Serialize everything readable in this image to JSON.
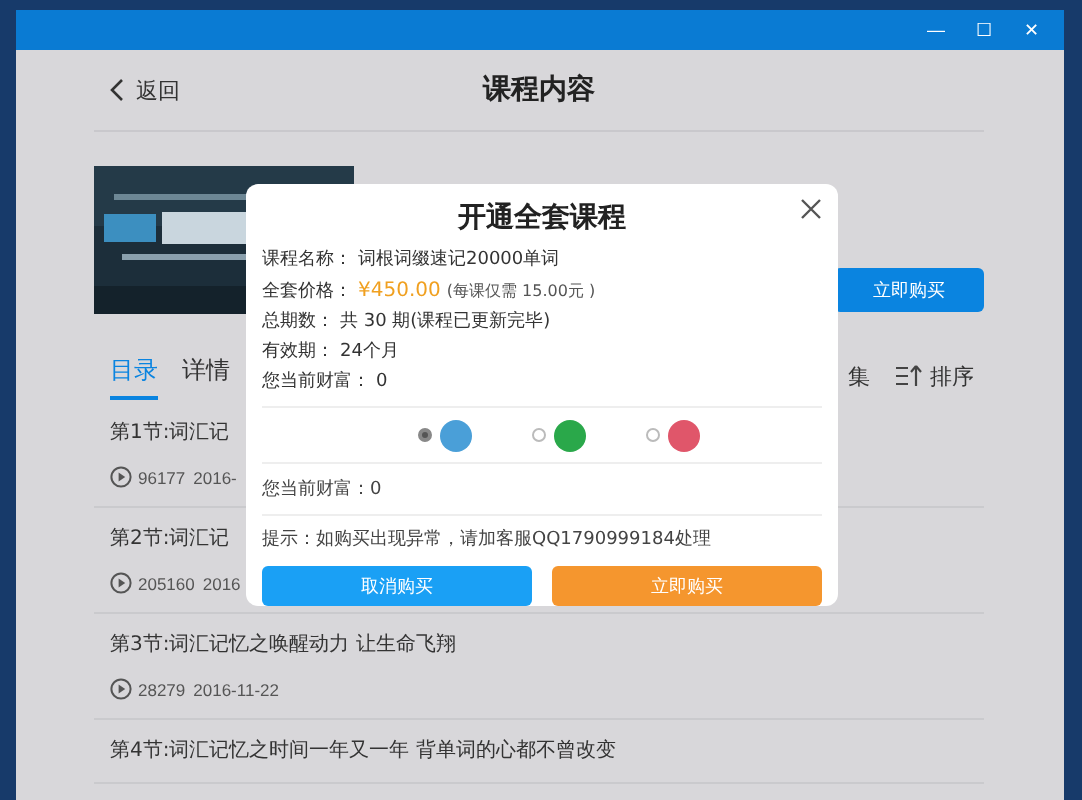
{
  "window": {
    "title_bar_buttons": [
      "—",
      "☐",
      "✕"
    ]
  },
  "header": {
    "back": "返回",
    "title": "课程内容"
  },
  "course": {
    "buy_button": "立即购买"
  },
  "tabs": [
    {
      "label": "目录",
      "selected": true
    },
    {
      "label": "详情",
      "selected": false
    }
  ],
  "tools": {
    "select": "集",
    "sort": "排序"
  },
  "lessons": [
    {
      "title": "第1节:词汇记",
      "plays": "96177",
      "date": "2016-"
    },
    {
      "title": "第2节:词汇记",
      "plays": "205160",
      "date": "2016"
    },
    {
      "title": "第3节:词汇记忆之唤醒动力 让生命飞翔",
      "plays": "28279",
      "date": "2016-11-22"
    },
    {
      "title": "第4节:词汇记忆之时间一年又一年 背单词的心都不曾改变"
    }
  ],
  "dialog": {
    "title": "开通全套课程",
    "info": [
      {
        "label": "课程名称：",
        "value": "词根词缀速记20000单词"
      },
      {
        "label": "全套价格：",
        "value": "¥450.00",
        "note": "(每课仅需 15.00元 )"
      },
      {
        "label": "总期数：",
        "value": "共 30 期(课程已更新完毕)"
      },
      {
        "label": "有效期：",
        "value": "24个月"
      },
      {
        "label": "您当前财富：",
        "value": "0"
      }
    ],
    "payment_methods": [
      {
        "color": "#4a9fd8",
        "selected": true
      },
      {
        "color": "#2aa84a",
        "selected": false
      },
      {
        "color": "#e0566a",
        "selected": false
      }
    ],
    "wealth": "您当前财富：0",
    "hint": "提示：如购买出现异常，请加客服QQ1790999184处理",
    "cancel": "取消购买",
    "confirm": "立即购买"
  }
}
